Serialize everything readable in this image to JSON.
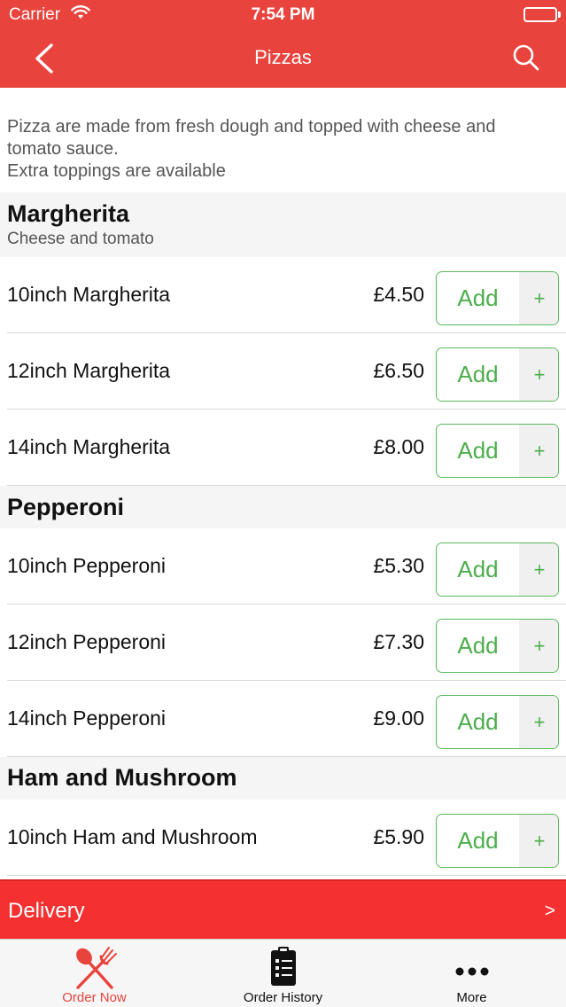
{
  "status": {
    "carrier": "Carrier",
    "time": "7:54 PM"
  },
  "nav": {
    "title": "Pizzas",
    "back_icon": "chevron-left-icon",
    "search_icon": "search-icon"
  },
  "intro": {
    "line1": "Pizza are made from fresh dough and topped with cheese and",
    "line2": "tomato sauce.",
    "line3": "Extra toppings are available"
  },
  "sections": [
    {
      "title": "Margherita",
      "description": "Cheese and tomato",
      "items": [
        {
          "name": "10inch Margherita",
          "price": "£4.50"
        },
        {
          "name": "12inch Margherita",
          "price": "£6.50"
        },
        {
          "name": "14inch Margherita",
          "price": "£8.00"
        }
      ]
    },
    {
      "title": "Pepperoni",
      "items": [
        {
          "name": "10inch Pepperoni",
          "price": "£5.30"
        },
        {
          "name": "12inch Pepperoni",
          "price": "£7.30"
        },
        {
          "name": "14inch Pepperoni",
          "price": "£9.00"
        }
      ]
    },
    {
      "title": "Ham and Mushroom",
      "items": [
        {
          "name": "10inch Ham and Mushroom",
          "price": "£5.90"
        }
      ]
    }
  ],
  "add_button": {
    "label": "Add",
    "plus": "+"
  },
  "delivery": {
    "label": "Delivery",
    "arrow": ">"
  },
  "tabs": [
    {
      "label": "Order Now",
      "icon": "fork-knife-icon",
      "active": true
    },
    {
      "label": "Order History",
      "icon": "clipboard-list-icon",
      "active": false
    },
    {
      "label": "More",
      "icon": "more-dots-icon",
      "active": false
    }
  ],
  "colors": {
    "brand_red": "#e8433c",
    "delivery_red": "#f53030",
    "add_green": "#4cae4c",
    "section_bg": "#f5f5f5"
  }
}
